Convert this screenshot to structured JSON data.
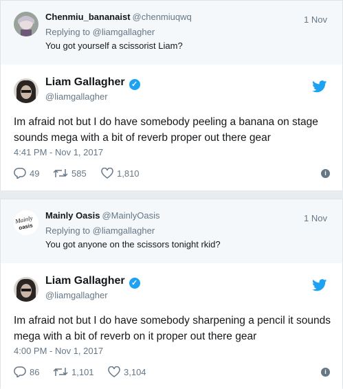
{
  "tweets": [
    {
      "reply": {
        "name": "Chenmiu_bananaist",
        "handle": "@chenmiuqwq",
        "date": "1 Nov",
        "replying_label": "Replying to @liamgallagher",
        "text": "You got yourself a scissorist Liam?",
        "avatar_icon": "anime-avatar-icon"
      },
      "main": {
        "name": "Liam Gallagher",
        "handle": "@liamgallagher",
        "text": "Im afraid not but I do have somebody peeling a banana on stage sounds mega with a bit of reverb proper out there gear",
        "time": "4:41 PM - Nov 1, 2017",
        "replies": "49",
        "retweets": "585",
        "likes": "1,810"
      }
    },
    {
      "reply": {
        "name": "Mainly Oasis",
        "handle": "@MainlyOasis",
        "date": "1 Nov",
        "replying_label": "Replying to @liamgallagher",
        "text": "You got anyone on the scissors tonight rkid?",
        "avatar_logo_text": "Mainly Oasis"
      },
      "main": {
        "name": "Liam Gallagher",
        "handle": "@liamgallagher",
        "text": "Im afraid not but I do have somebody sharpening a pencil it sounds mega with a bit of reverb on it proper out there gear",
        "time": "4:00 PM - Nov 1, 2017",
        "replies": "86",
        "retweets": "1,101",
        "likes": "3,104"
      }
    }
  ],
  "colors": {
    "twitter_blue": "#1da1f2",
    "muted": "#657786",
    "text": "#14171a",
    "reply_bg": "#f5f8fa"
  },
  "info_glyph": "i"
}
